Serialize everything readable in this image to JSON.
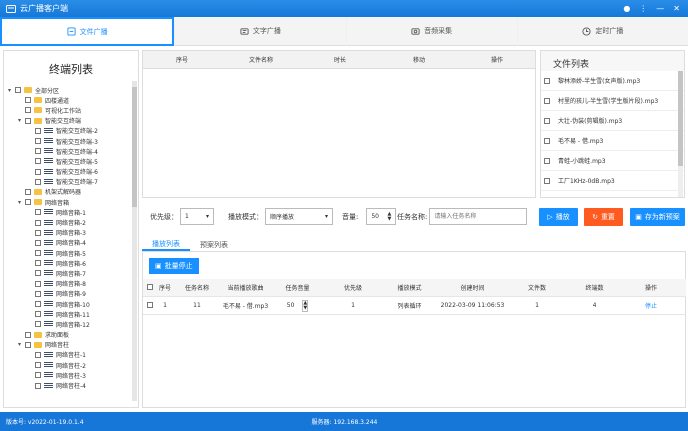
{
  "app": {
    "title": "云广播客户端"
  },
  "tabs": [
    {
      "label": "文件广播",
      "icon": "file-broadcast-icon"
    },
    {
      "label": "文字广播",
      "icon": "text-broadcast-icon"
    },
    {
      "label": "音频采集",
      "icon": "audio-capture-icon"
    },
    {
      "label": "定时广播",
      "icon": "clock-icon"
    }
  ],
  "terminal_list": {
    "title": "终端列表",
    "nodes": [
      {
        "label": "全部分区",
        "depth": 0,
        "expand": "▾",
        "type": "folder"
      },
      {
        "label": "四楼通道",
        "depth": 1,
        "expand": "",
        "type": "folder"
      },
      {
        "label": "可视化工作站",
        "depth": 1,
        "expand": "",
        "type": "folder"
      },
      {
        "label": "智能交互终端",
        "depth": 1,
        "expand": "▾",
        "type": "folder"
      },
      {
        "label": "智能交互终端-2",
        "depth": 2,
        "expand": "",
        "type": "dev"
      },
      {
        "label": "智能交互终端-3",
        "depth": 2,
        "expand": "",
        "type": "dev"
      },
      {
        "label": "智能交互终端-4",
        "depth": 2,
        "expand": "",
        "type": "dev"
      },
      {
        "label": "智能交互终端-5",
        "depth": 2,
        "expand": "",
        "type": "dev"
      },
      {
        "label": "智能交互终端-6",
        "depth": 2,
        "expand": "",
        "type": "dev"
      },
      {
        "label": "智能交互终端-7",
        "depth": 2,
        "expand": "",
        "type": "dev"
      },
      {
        "label": "机架式解码器",
        "depth": 1,
        "expand": "",
        "type": "folder"
      },
      {
        "label": "网络音箱",
        "depth": 1,
        "expand": "▾",
        "type": "folder"
      },
      {
        "label": "网络音箱-1",
        "depth": 2,
        "expand": "",
        "type": "dev"
      },
      {
        "label": "网络音箱-2",
        "depth": 2,
        "expand": "",
        "type": "dev"
      },
      {
        "label": "网络音箱-3",
        "depth": 2,
        "expand": "",
        "type": "dev"
      },
      {
        "label": "网络音箱-4",
        "depth": 2,
        "expand": "",
        "type": "dev"
      },
      {
        "label": "网络音箱-5",
        "depth": 2,
        "expand": "",
        "type": "dev"
      },
      {
        "label": "网络音箱-6",
        "depth": 2,
        "expand": "",
        "type": "dev"
      },
      {
        "label": "网络音箱-7",
        "depth": 2,
        "expand": "",
        "type": "dev"
      },
      {
        "label": "网络音箱-8",
        "depth": 2,
        "expand": "",
        "type": "dev"
      },
      {
        "label": "网络音箱-9",
        "depth": 2,
        "expand": "",
        "type": "dev"
      },
      {
        "label": "网络音箱-10",
        "depth": 2,
        "expand": "",
        "type": "dev"
      },
      {
        "label": "网络音箱-11",
        "depth": 2,
        "expand": "",
        "type": "dev"
      },
      {
        "label": "网络音箱-12",
        "depth": 2,
        "expand": "",
        "type": "dev"
      },
      {
        "label": "求助面板",
        "depth": 1,
        "expand": "",
        "type": "folder"
      },
      {
        "label": "网络音柱",
        "depth": 1,
        "expand": "▾",
        "type": "folder"
      },
      {
        "label": "网络音柱-1",
        "depth": 2,
        "expand": "",
        "type": "dev"
      },
      {
        "label": "网络音柱-2",
        "depth": 2,
        "expand": "",
        "type": "dev"
      },
      {
        "label": "网络音柱-3",
        "depth": 2,
        "expand": "",
        "type": "dev"
      },
      {
        "label": "网络音柱-4",
        "depth": 2,
        "expand": "",
        "type": "dev"
      }
    ]
  },
  "playlist_table": {
    "headers": [
      "序号",
      "文件名称",
      "时长",
      "移动",
      "操作"
    ]
  },
  "file_list": {
    "title": "文件列表",
    "files": [
      "黎林添娇-半生雪(女声版).mp3",
      "村里的孩儿-半生雪(学生版片段).mp3",
      "大壮-伪装(剪辑版).mp3",
      "毛不易 - 借.mp3",
      "青蛙-小跳蛙.mp3",
      "工厂1KHz-0dB.mp3"
    ]
  },
  "controls": {
    "priority_label": "优先级：",
    "priority_value": "1",
    "mode_label": "播放模式：",
    "mode_value": "顺序播放",
    "volume_label": "音量:",
    "volume_value": "50",
    "task_label": "任务名称:",
    "task_placeholder": "请输入任务名称",
    "play_btn": "播放",
    "reset_btn": "重置",
    "save_btn": "存为新预案"
  },
  "subtabs": [
    "播放列表",
    "预案列表"
  ],
  "batch_stop": "批量停止",
  "tasks": {
    "headers": [
      "序号",
      "任务名称",
      "当前播放歌曲",
      "任务音量",
      "优先级",
      "播放模式",
      "创建时间",
      "文件数",
      "终端数",
      "操作"
    ],
    "rows": [
      {
        "no": "1",
        "name": "11",
        "song": "毛不易 - 借.mp3",
        "volume": "50",
        "priority": "1",
        "mode": "列表循环",
        "created": "2022-03-09 11:06:53",
        "files": "1",
        "terminals": "4",
        "action": "停止"
      }
    ]
  },
  "footer": {
    "version": "版本号: v2022-01-19.0.1.4",
    "server": "服务器: 192.168.3.244"
  }
}
